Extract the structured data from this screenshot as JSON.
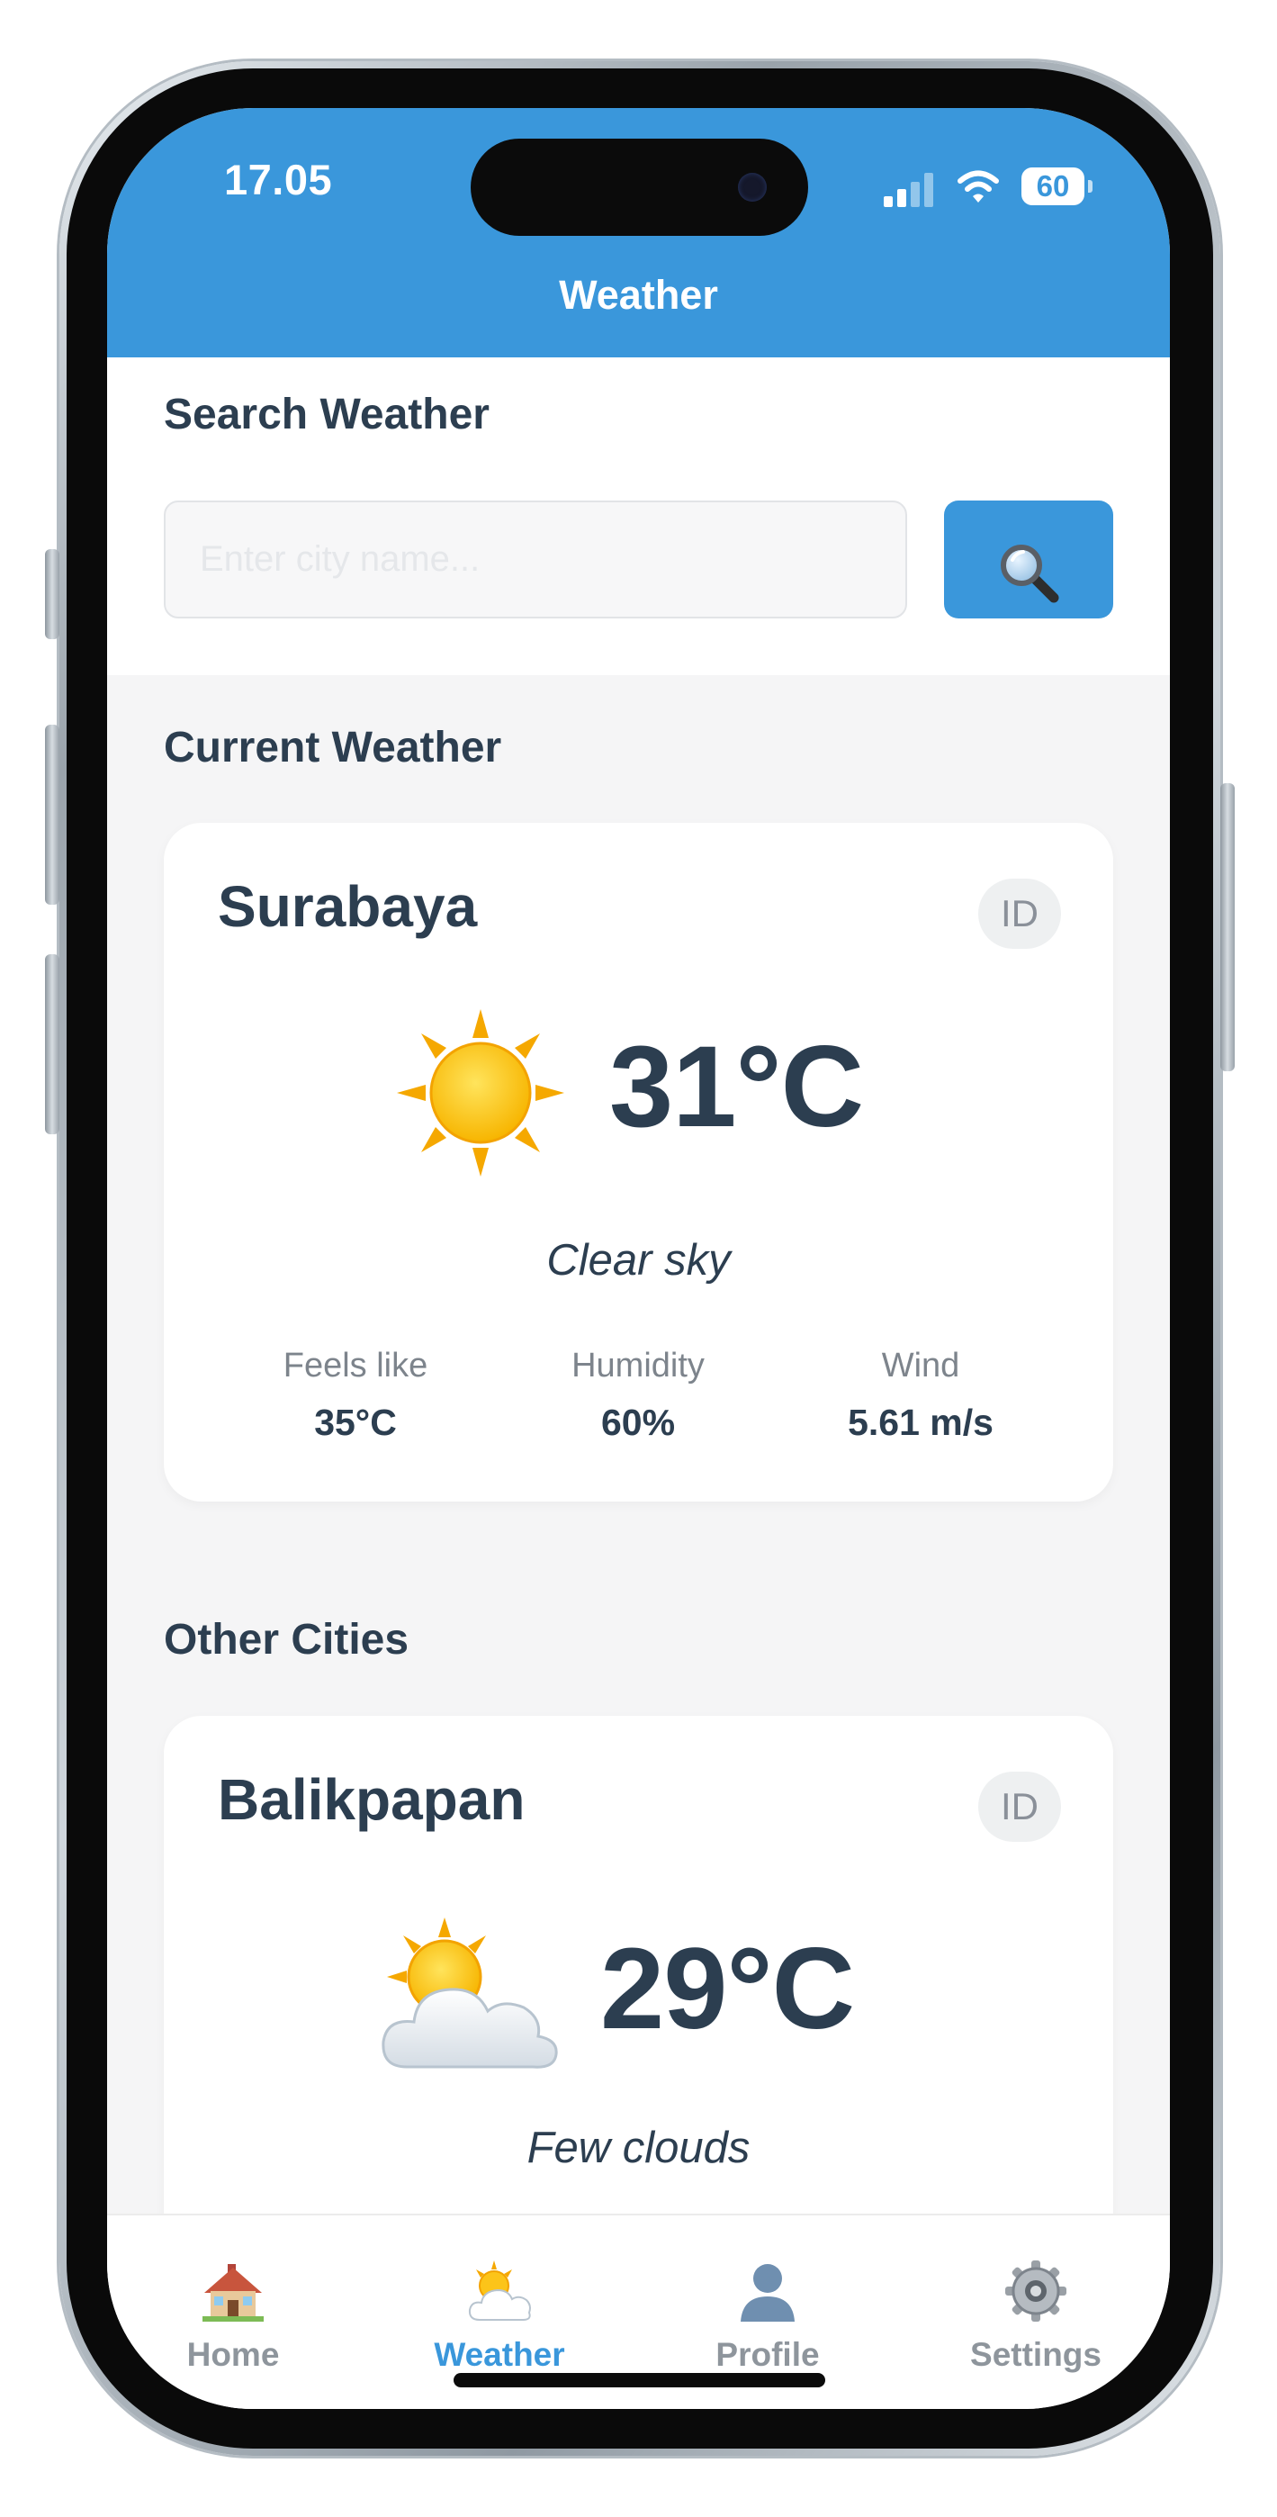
{
  "status_bar": {
    "time": "17.05",
    "battery": "60"
  },
  "header": {
    "title": "Weather"
  },
  "search": {
    "title": "Search Weather",
    "placeholder": "Enter city name..."
  },
  "current": {
    "section_title": "Current Weather",
    "city": "Surabaya",
    "country": "ID",
    "icon": "sun-icon",
    "temperature": "31°C",
    "description": "Clear sky",
    "stats": [
      {
        "label": "Feels like",
        "value": "35°C"
      },
      {
        "label": "Humidity",
        "value": "60%"
      },
      {
        "label": "Wind",
        "value": "5.61 m/s"
      }
    ]
  },
  "other": {
    "section_title": "Other Cities",
    "cities": [
      {
        "city": "Balikpapan",
        "country": "ID",
        "icon": "sun-behind-cloud-icon",
        "temperature": "29°C",
        "description": "Few clouds"
      }
    ]
  },
  "tabs": [
    {
      "label": "Home",
      "icon": "house-icon",
      "active": false
    },
    {
      "label": "Weather",
      "icon": "weather-icon",
      "active": true
    },
    {
      "label": "Profile",
      "icon": "person-icon",
      "active": false
    },
    {
      "label": "Settings",
      "icon": "gear-icon",
      "active": false
    }
  ],
  "colors": {
    "accent": "#3a97db",
    "text": "#2c3e50",
    "muted": "#8e959c",
    "background": "#f5f5f6"
  }
}
